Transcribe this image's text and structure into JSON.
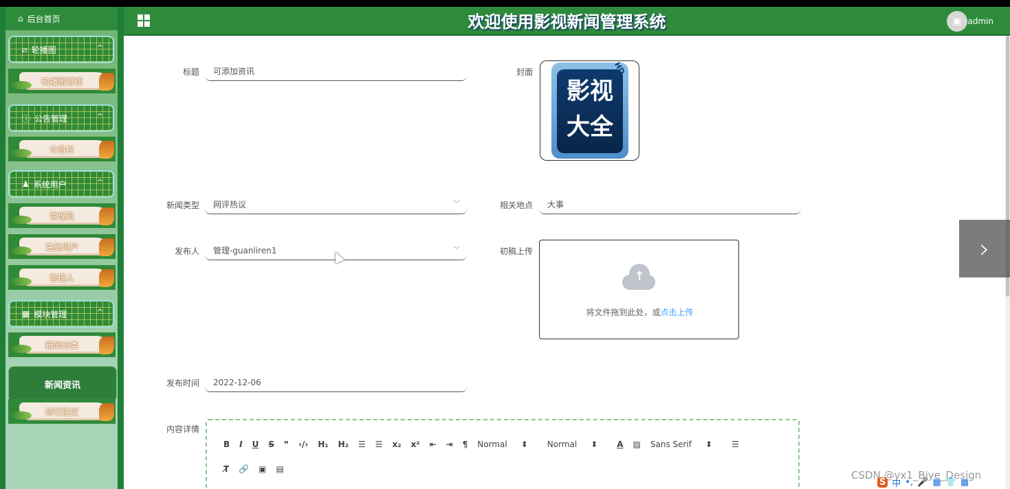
{
  "header": {
    "title": "欢迎使用影视新闻管理系统",
    "username": "admin"
  },
  "sidebar": {
    "home": "后台首页",
    "groups": [
      {
        "label": "轮播图",
        "items": [
          "轮播图管理"
        ]
      },
      {
        "label": "公告管理",
        "items": [
          "公告栏"
        ]
      },
      {
        "label": "系统用户",
        "items": [
          "管理员",
          "注册用户",
          "管理人"
        ]
      },
      {
        "label": "模块管理",
        "items": [
          "新闻分类",
          "新闻资讯",
          "修订建议"
        ]
      }
    ],
    "active": "新闻资讯"
  },
  "form": {
    "title_label": "标题",
    "title_value": "可添加资讯",
    "cover_label": "封面",
    "cover_text_1": "影视",
    "cover_text_2": "大全",
    "cover_hd": "HD",
    "type_label": "新闻类型",
    "type_value": "网评热议",
    "place_label": "相关地点",
    "place_value": "大事",
    "publisher_label": "发布人",
    "publisher_value": "管理-guanliren1",
    "draft_label": "初稿上传",
    "upload_text": "将文件拖到此处，或",
    "upload_link": "点击上传",
    "time_label": "发布时间",
    "time_value": "2022-12-06",
    "content_label": "内容详情"
  },
  "editor": {
    "row1": [
      "B",
      "I",
      "U",
      "S",
      "❞",
      "‹/›",
      "H₁",
      "H₂",
      "☰",
      "☰",
      "x₂",
      "x²",
      "⇤",
      "⇥",
      "¶"
    ],
    "size_select": "Normal",
    "header_select": "Normal",
    "font_select": "Sans Serif",
    "row2": [
      "T̸",
      "🔗",
      "▣",
      "▤"
    ]
  },
  "watermark": "CSDN @vx1_Biye_Design",
  "ime": [
    "S",
    "中",
    "•,",
    "🎤",
    "▦",
    "👕",
    "▦"
  ]
}
